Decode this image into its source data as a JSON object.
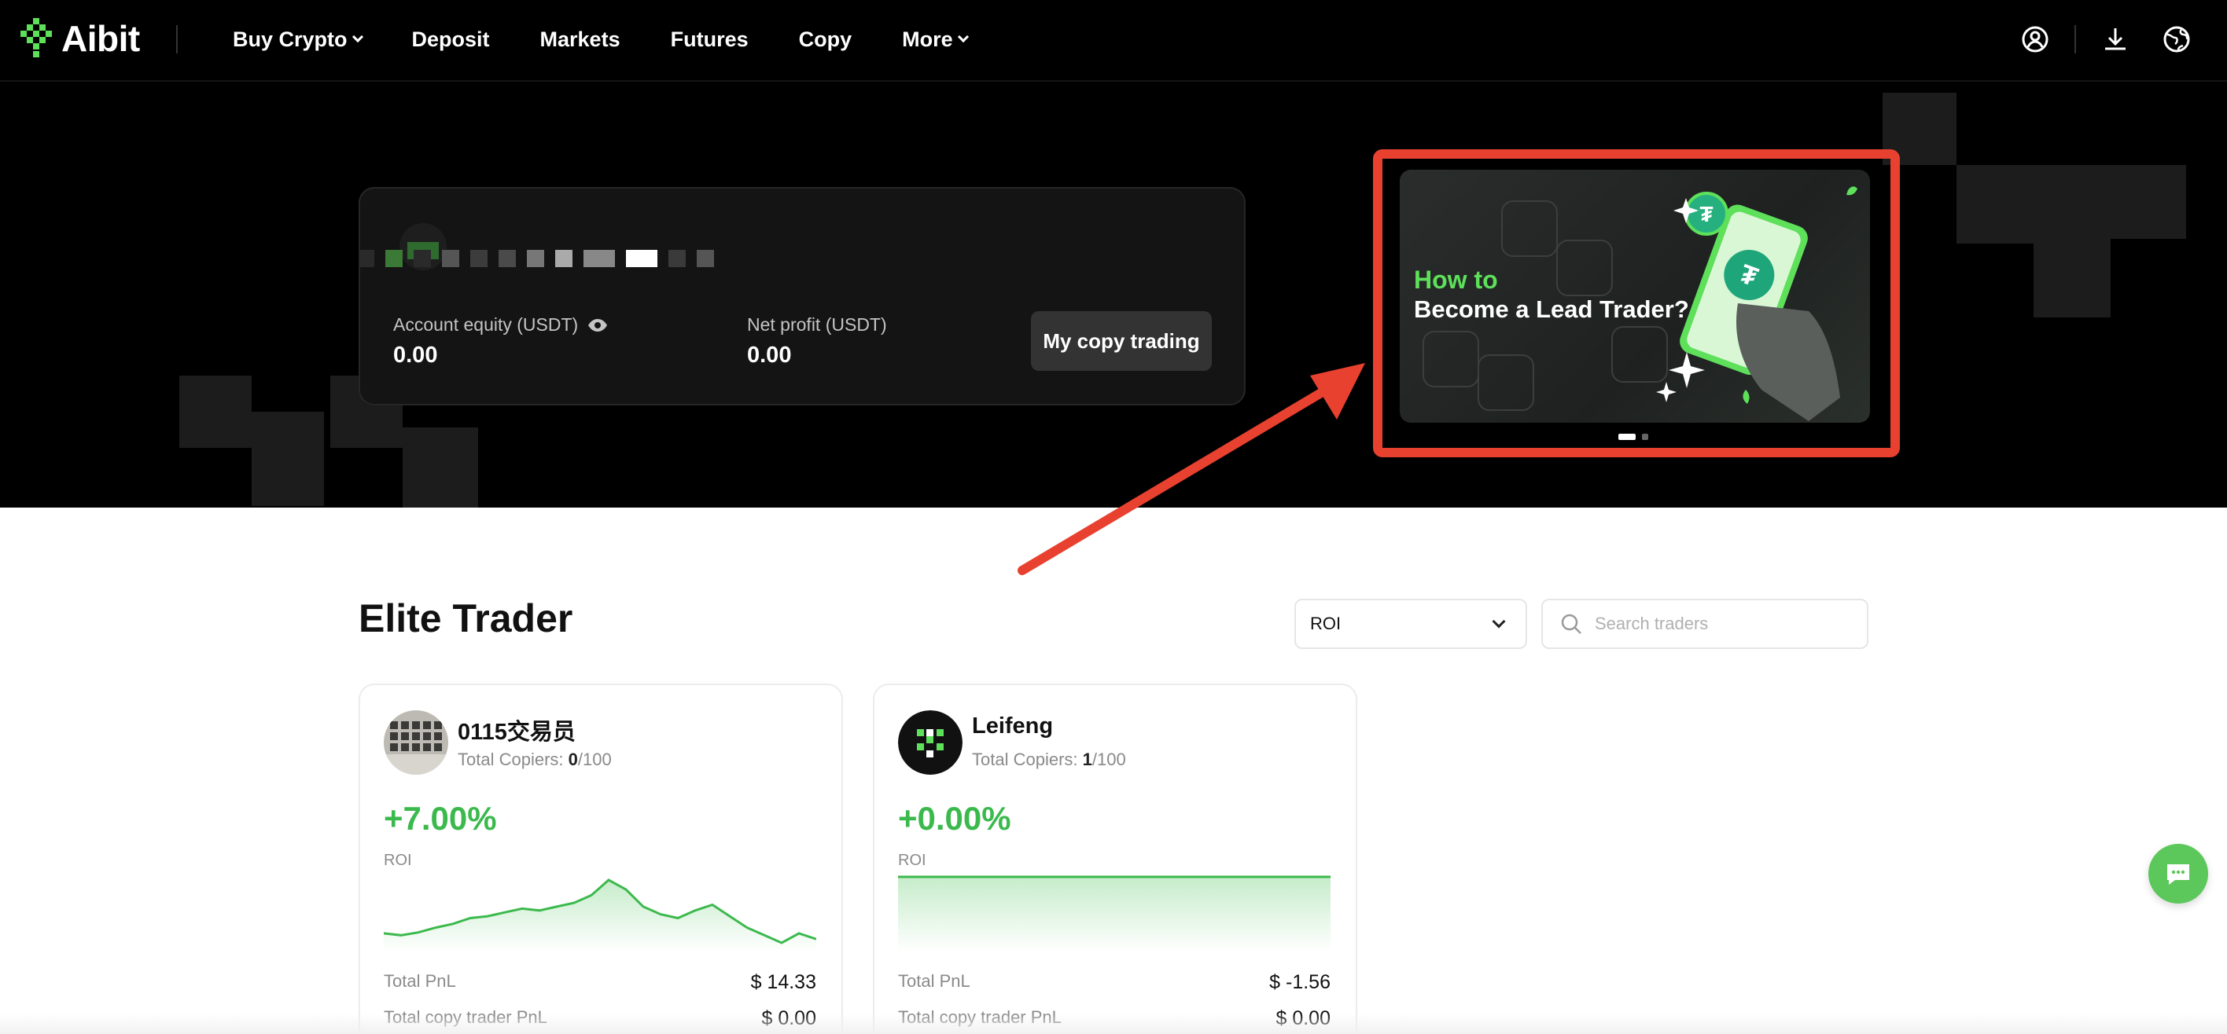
{
  "brand": {
    "name": "Aibit",
    "accent": "#5ee05a"
  },
  "nav": {
    "links": [
      {
        "label": "Buy Crypto",
        "dropdown": true
      },
      {
        "label": "Deposit",
        "dropdown": false
      },
      {
        "label": "Markets",
        "dropdown": false
      },
      {
        "label": "Futures",
        "dropdown": false
      },
      {
        "label": "Copy",
        "dropdown": false
      },
      {
        "label": "More",
        "dropdown": true
      }
    ],
    "icons": [
      "user-icon",
      "download-icon",
      "globe-icon"
    ]
  },
  "account": {
    "equity_label": "Account equity (USDT)",
    "equity_value": "0.00",
    "profit_label": "Net profit (USDT)",
    "profit_value": "0.00",
    "button_label": "My copy trading"
  },
  "banner": {
    "line1": "How to",
    "line2": "Become a Lead Trader?"
  },
  "elite": {
    "title": "Elite Trader",
    "sort_selected": "ROI",
    "search_placeholder": "Search traders"
  },
  "traders": [
    {
      "name": "0115交易员",
      "copiers_label": "Total Copiers:",
      "copiers_current": "0",
      "copiers_max": "/100",
      "roi": "+7.00%",
      "roi_label": "ROI",
      "pnl_label": "Total PnL",
      "pnl_value": "$ 14.33",
      "copy_pnl_label": "Total copy trader PnL",
      "copy_pnl_value": "$ 0.00",
      "spark": [
        36,
        38,
        35,
        30,
        26,
        20,
        18,
        14,
        10,
        12,
        8,
        4,
        -4,
        -20,
        -10,
        8,
        16,
        20,
        12,
        6,
        18,
        30,
        38,
        46,
        36,
        42
      ]
    },
    {
      "name": "Leifeng",
      "copiers_label": "Total Copiers:",
      "copiers_current": "1",
      "copiers_max": "/100",
      "roi": "+0.00%",
      "roi_label": "ROI",
      "pnl_label": "Total PnL",
      "pnl_value": "$ -1.56",
      "copy_pnl_label": "Total copy trader PnL",
      "copy_pnl_value": "$ 0.00",
      "spark": [
        0,
        0
      ]
    }
  ]
}
